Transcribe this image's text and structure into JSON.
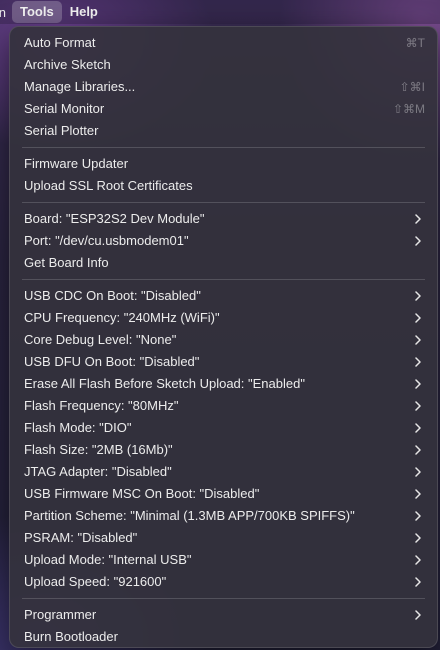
{
  "menubar": {
    "edge_label": "n",
    "tools": "Tools",
    "help": "Help"
  },
  "menu": {
    "sections": [
      [
        {
          "label": "Auto Format",
          "shortcut": "⌘T"
        },
        {
          "label": "Archive Sketch"
        },
        {
          "label": "Manage Libraries...",
          "shortcut": "⇧⌘I"
        },
        {
          "label": "Serial Monitor",
          "shortcut": "⇧⌘M"
        },
        {
          "label": "Serial Plotter"
        }
      ],
      [
        {
          "label": "Firmware Updater"
        },
        {
          "label": "Upload SSL Root Certificates"
        }
      ],
      [
        {
          "label": "Board: \"ESP32S2 Dev Module\"",
          "submenu": true
        },
        {
          "label": "Port: \"/dev/cu.usbmodem01\"",
          "submenu": true
        },
        {
          "label": "Get Board Info"
        }
      ],
      [
        {
          "label": "USB CDC On Boot: \"Disabled\"",
          "submenu": true
        },
        {
          "label": "CPU Frequency: \"240MHz (WiFi)\"",
          "submenu": true
        },
        {
          "label": "Core Debug Level: \"None\"",
          "submenu": true
        },
        {
          "label": "USB DFU On Boot: \"Disabled\"",
          "submenu": true
        },
        {
          "label": "Erase All Flash Before Sketch Upload: \"Enabled\"",
          "submenu": true
        },
        {
          "label": "Flash Frequency: \"80MHz\"",
          "submenu": true
        },
        {
          "label": "Flash Mode: \"DIO\"",
          "submenu": true
        },
        {
          "label": "Flash Size: \"2MB (16Mb)\"",
          "submenu": true
        },
        {
          "label": "JTAG Adapter: \"Disabled\"",
          "submenu": true
        },
        {
          "label": "USB Firmware MSC On Boot: \"Disabled\"",
          "submenu": true
        },
        {
          "label": "Partition Scheme: \"Minimal (1.3MB APP/700KB SPIFFS)\"",
          "submenu": true
        },
        {
          "label": "PSRAM: \"Disabled\"",
          "submenu": true
        },
        {
          "label": "Upload Mode: \"Internal USB\"",
          "submenu": true
        },
        {
          "label": "Upload Speed: \"921600\"",
          "submenu": true
        }
      ],
      [
        {
          "label": "Programmer",
          "submenu": true
        },
        {
          "label": "Burn Bootloader"
        }
      ]
    ]
  },
  "colors": {
    "menu_bg": "#34323c",
    "text": "#ececec",
    "shortcut_text": "#6a6a70"
  }
}
